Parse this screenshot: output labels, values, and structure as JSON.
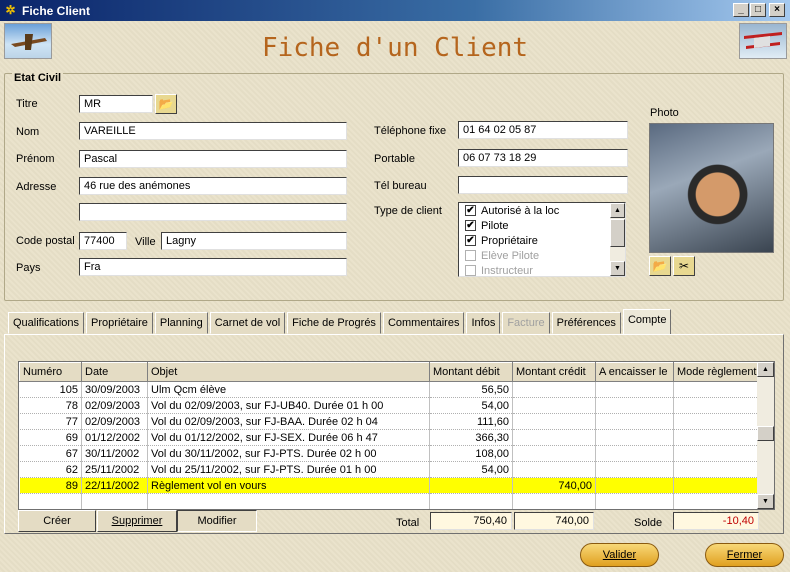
{
  "window": {
    "title": "Fiche Client",
    "minimize": "_",
    "maximize": "□",
    "close": "×"
  },
  "heading": "Fiche d'un Client",
  "etat_civil": {
    "title": "Etat Civil",
    "titre_label": "Titre",
    "titre_value": "MR",
    "nom_label": "Nom",
    "nom_value": "VAREILLE",
    "prenom_label": "Prénom",
    "prenom_value": "Pascal",
    "adresse_label": "Adresse",
    "adresse_value": "46 rue des anémones",
    "adresse2_value": "",
    "cp_label": "Code postal",
    "cp_value": "77400",
    "ville_label": "Ville",
    "ville_value": "Lagny",
    "pays_label": "Pays",
    "pays_value": "Fra",
    "tel_fixe_label": "Téléphone fixe",
    "tel_fixe_value": "01 64 02 05 87",
    "portable_label": "Portable",
    "portable_value": "06 07 73 18 29",
    "tel_bureau_label": "Tél bureau",
    "tel_bureau_value": "",
    "type_client_label": "Type de client",
    "type_client_options": [
      {
        "label": "Autorisé à la loc",
        "checked": true,
        "enabled": true
      },
      {
        "label": "Pilote",
        "checked": true,
        "enabled": true
      },
      {
        "label": "Propriétaire",
        "checked": true,
        "enabled": true
      },
      {
        "label": "Elève Pilote",
        "checked": false,
        "enabled": false
      },
      {
        "label": "Instructeur",
        "checked": false,
        "enabled": false
      }
    ],
    "photo_label": "Photo"
  },
  "tabs": [
    {
      "label": "Qualifications",
      "active": false,
      "enabled": true
    },
    {
      "label": "Propriétaire",
      "active": false,
      "enabled": true
    },
    {
      "label": "Planning",
      "active": false,
      "enabled": true
    },
    {
      "label": "Carnet de vol",
      "active": false,
      "enabled": true
    },
    {
      "label": "Fiche de Progrés",
      "active": false,
      "enabled": true
    },
    {
      "label": "Commentaires",
      "active": false,
      "enabled": true
    },
    {
      "label": "Infos",
      "active": false,
      "enabled": true
    },
    {
      "label": "Facture",
      "active": false,
      "enabled": false
    },
    {
      "label": "Préférences",
      "active": false,
      "enabled": true
    },
    {
      "label": "Compte",
      "active": true,
      "enabled": true
    }
  ],
  "compte": {
    "columns": [
      "Numéro",
      "Date",
      "Objet",
      "Montant débit",
      "Montant crédit",
      "A encaisser le",
      "Mode règlement"
    ],
    "rows": [
      {
        "numero": "105",
        "date": "30/09/2003",
        "objet": "Ulm Qcm élève",
        "debit": "56,50",
        "credit": "",
        "encaisser": "",
        "mode": "",
        "selected": false
      },
      {
        "numero": "78",
        "date": "02/09/2003",
        "objet": "Vol du 02/09/2003, sur  FJ-UB40. Durée 01 h 00",
        "debit": "54,00",
        "credit": "",
        "encaisser": "",
        "mode": "",
        "selected": false
      },
      {
        "numero": "77",
        "date": "02/09/2003",
        "objet": "Vol du 02/09/2003, sur  FJ-BAA. Durée 02 h 04",
        "debit": "111,60",
        "credit": "",
        "encaisser": "",
        "mode": "",
        "selected": false
      },
      {
        "numero": "69",
        "date": "01/12/2002",
        "objet": "Vol du 01/12/2002, sur  FJ-SEX. Durée 06 h 47",
        "debit": "366,30",
        "credit": "",
        "encaisser": "",
        "mode": "",
        "selected": false
      },
      {
        "numero": "67",
        "date": "30/11/2002",
        "objet": "Vol du 30/11/2002, sur  FJ-PTS. Durée 02 h 00",
        "debit": "108,00",
        "credit": "",
        "encaisser": "",
        "mode": "",
        "selected": false
      },
      {
        "numero": "62",
        "date": "25/11/2002",
        "objet": "Vol du 25/11/2002, sur  FJ-PTS. Durée 01 h 00",
        "debit": "54,00",
        "credit": "",
        "encaisser": "",
        "mode": "",
        "selected": false
      },
      {
        "numero": "89",
        "date": "22/11/2002",
        "objet": "Règlement vol en vours",
        "debit": "",
        "credit": "740,00",
        "encaisser": "",
        "mode": "",
        "selected": true
      },
      {
        "numero": "",
        "date": "",
        "objet": "",
        "debit": "",
        "credit": "",
        "encaisser": "",
        "mode": "",
        "selected": false
      }
    ],
    "creer_label": "Créer",
    "supprimer_label": "Supprimer",
    "modifier_label": "Modifier",
    "total_label": "Total",
    "total_debit": "750,40",
    "total_credit": "740,00",
    "solde_label": "Solde",
    "solde_value": "-10,40"
  },
  "footer": {
    "valider_label": "Valider",
    "fermer_label": "Fermer"
  },
  "colors": {
    "heading": "#b5651d",
    "selected_row": "#ffff00",
    "solde": "#c00000"
  }
}
